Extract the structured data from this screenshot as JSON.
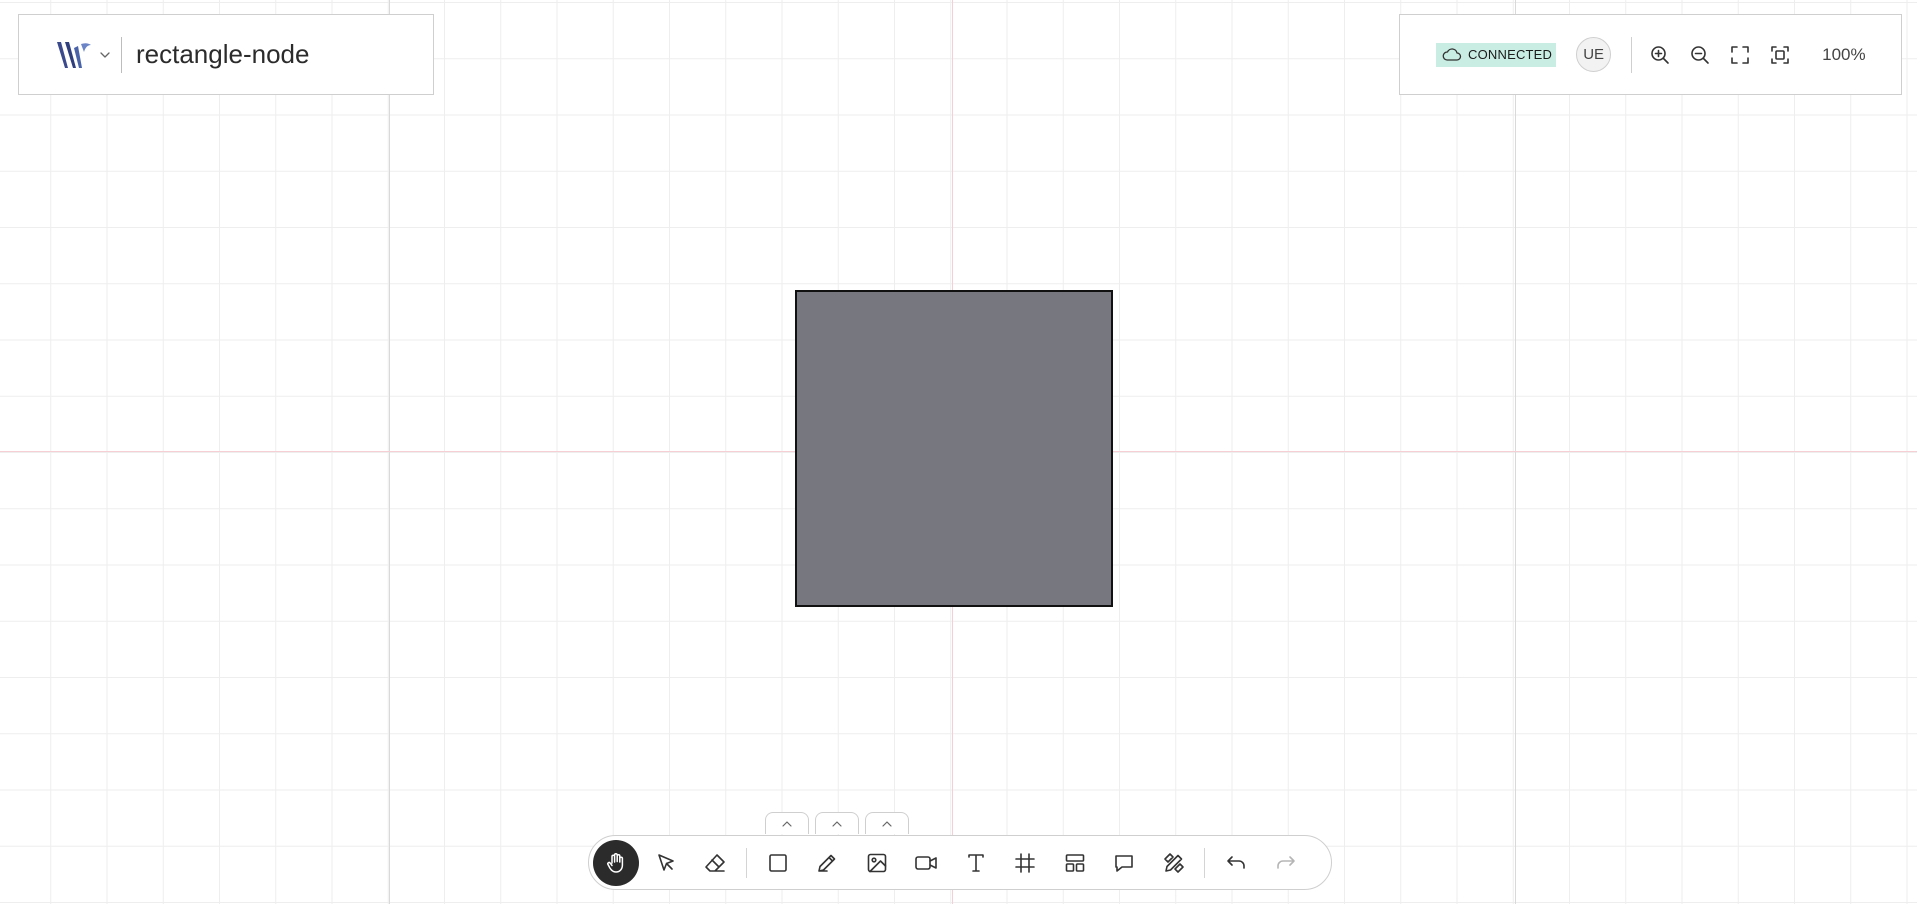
{
  "header": {
    "document_title": "rectangle-node"
  },
  "status": {
    "connection_label": "CONNECTED",
    "connection_color": "#c9ede3"
  },
  "user": {
    "avatar_initials": "UE"
  },
  "view": {
    "zoom_label": "100%",
    "controls": [
      "zoom-in-icon",
      "zoom-out-icon",
      "fullscreen-icon",
      "fit-to-screen-icon"
    ]
  },
  "canvas": {
    "node": {
      "type": "rectangle",
      "fill": "#777780",
      "stroke": "#111111"
    }
  },
  "toolbar": {
    "tools": [
      "hand-icon",
      "select-arrow-icon",
      "eraser-icon",
      "rectangle-icon",
      "pencil-icon",
      "image-icon",
      "video-icon",
      "text-icon",
      "frame-icon",
      "layout-icon",
      "comment-icon",
      "design-tools-icon",
      "undo-icon",
      "redo-icon"
    ],
    "active_tool": "hand-icon",
    "active_color": "#2b2b2b"
  }
}
